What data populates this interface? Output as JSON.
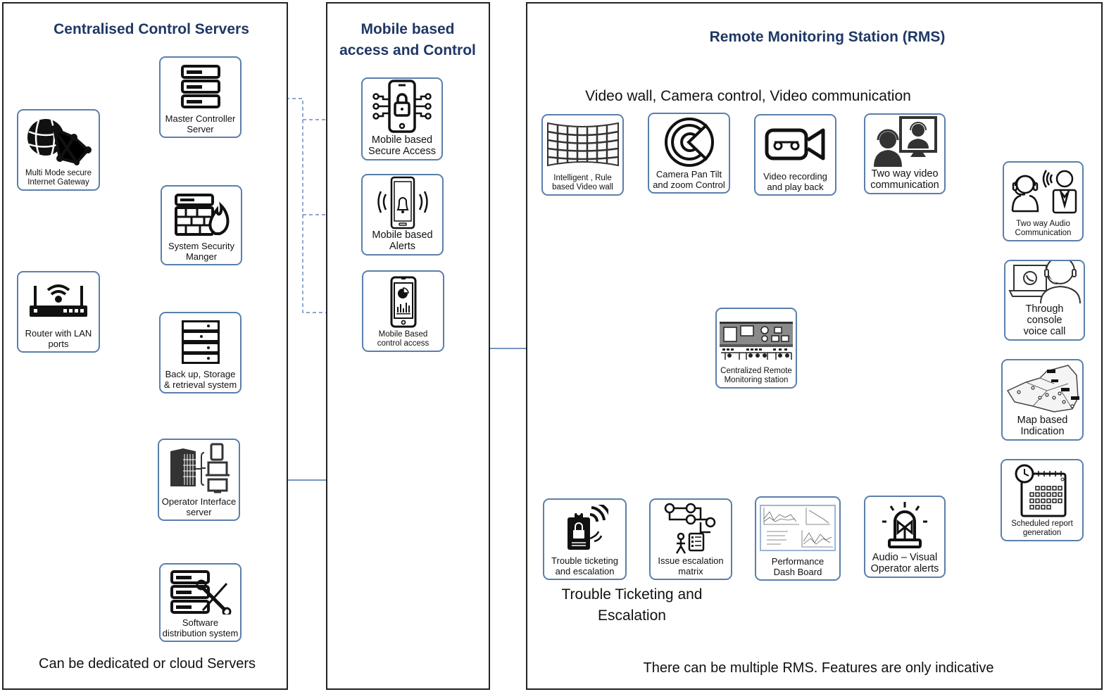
{
  "panels": {
    "servers": {
      "title": "Centralised Control Servers",
      "footer": "Can be dedicated or cloud Servers",
      "nodes": [
        {
          "id": "gateway",
          "label": "Multi Mode secure\nInternet Gateway",
          "icon": "globe-network-icon"
        },
        {
          "id": "router",
          "label": "Router with LAN\nports",
          "icon": "wifi-router-icon"
        },
        {
          "id": "master",
          "label": "Master Controller\nServer",
          "icon": "server-rack-icon"
        },
        {
          "id": "security",
          "label": "System Security\nManger",
          "icon": "firewall-server-icon"
        },
        {
          "id": "backup",
          "label": "Back up, Storage\n& retrieval system",
          "icon": "storage-server-icon"
        },
        {
          "id": "operator",
          "label": "Operator Interface\nserver",
          "icon": "operator-devices-icon"
        },
        {
          "id": "software",
          "label": "Software\ndistribution system",
          "icon": "server-tools-icon"
        }
      ]
    },
    "mobile": {
      "title": "Mobile based\naccess and Control",
      "nodes": [
        {
          "id": "secure",
          "label": "Mobile based\nSecure Access",
          "icon": "mobile-lock-icon"
        },
        {
          "id": "alerts",
          "label": "Mobile based\nAlerts",
          "icon": "mobile-bell-icon"
        },
        {
          "id": "control",
          "label": "Mobile Based\ncontrol access",
          "icon": "mobile-chart-icon"
        }
      ]
    },
    "rms": {
      "title": "Remote Monitoring Station (RMS)",
      "top_caption": "Video wall, Camera control, Video communication",
      "bottom_caption": "Trouble Ticketing and\nEscalation",
      "footer": "There can be multiple RMS. Features are only indicative",
      "center": {
        "id": "crms",
        "label": "Centralized Remote\nMonitoring station",
        "icon": "control-room-icon"
      },
      "top_nodes": [
        {
          "id": "videowall",
          "label": "Intelligent , Rule\nbased Video wall",
          "icon": "video-wall-icon"
        },
        {
          "id": "ptz",
          "label": "Camera Pan Tilt\nand zoom Control",
          "icon": "ptz-camera-icon"
        },
        {
          "id": "recording",
          "label": "Video recording\nand play back",
          "icon": "video-camera-icon"
        },
        {
          "id": "twovideo",
          "label": "Two way video\ncommunication",
          "icon": "video-call-icon"
        }
      ],
      "bottom_nodes": [
        {
          "id": "ticket",
          "label": "Trouble ticketing\nand escalation",
          "icon": "ticket-clipboard-icon"
        },
        {
          "id": "matrix",
          "label": "Issue escalation\nmatrix",
          "icon": "escalation-flow-icon"
        },
        {
          "id": "dashboard",
          "label": "Performance\nDash Board",
          "icon": "dashboard-charts-icon"
        },
        {
          "id": "avalert",
          "label": "Audio – Visual\nOperator alerts",
          "icon": "siren-icon"
        }
      ],
      "right_nodes": [
        {
          "id": "audio",
          "label": "Two way Audio\nCommunication",
          "icon": "headset-audio-icon"
        },
        {
          "id": "console",
          "label": "Through console\nvoice call",
          "icon": "console-call-icon"
        },
        {
          "id": "map",
          "label": "Map based\nIndication",
          "icon": "map-pins-icon"
        },
        {
          "id": "report",
          "label": "Scheduled report\ngeneration",
          "icon": "calendar-clock-icon"
        }
      ]
    }
  },
  "colors": {
    "title": "#1f3864",
    "border": "#5a7fab",
    "wire": "#4a72b0"
  }
}
